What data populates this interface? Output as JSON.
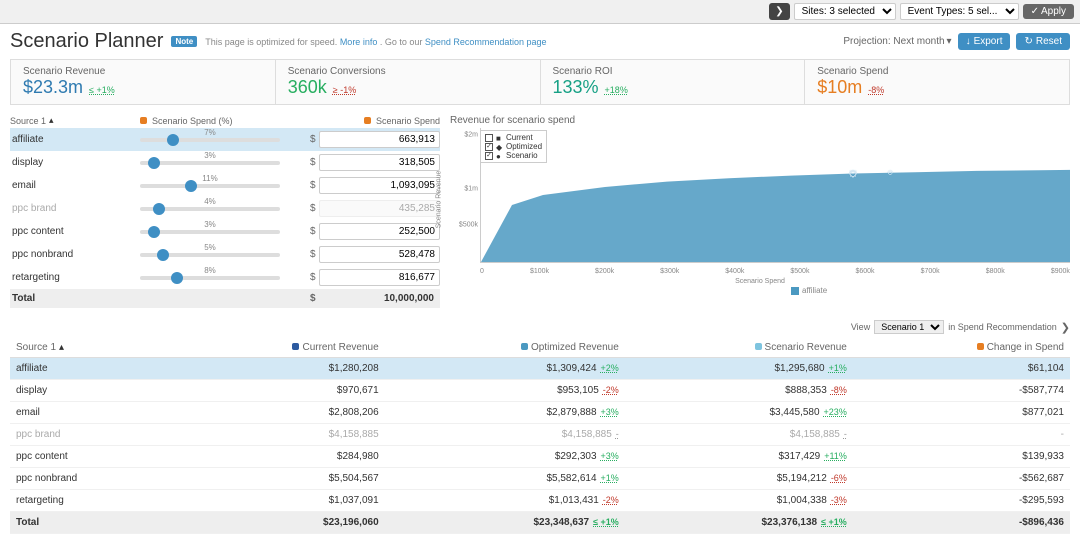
{
  "topbar": {
    "sites_label": "Sites: 3 selected",
    "event_types_label": "Event Types: 5 sel...",
    "apply_label": "Apply"
  },
  "header": {
    "title": "Scenario Planner",
    "note_badge": "Note",
    "note_text": "This page is optimized for speed.",
    "more_info": "More info",
    "goto_text": ". Go to our ",
    "rec_link": "Spend Recommendation page",
    "projection_label": "Projection:",
    "projection_value": "Next month",
    "export_label": "Export",
    "reset_label": "Reset"
  },
  "kpis": [
    {
      "label": "Scenario Revenue",
      "value": "$23.3m",
      "delta": "≤ +1%",
      "sign": "pos",
      "color": "blue"
    },
    {
      "label": "Scenario Conversions",
      "value": "360k",
      "delta": "≥ -1%",
      "sign": "neg",
      "color": "green"
    },
    {
      "label": "Scenario ROI",
      "value": "133%",
      "delta": "+18%",
      "sign": "pos",
      "color": "teal"
    },
    {
      "label": "Scenario Spend",
      "value": "$10m",
      "delta": "-8%",
      "sign": "neg",
      "color": "orange"
    }
  ],
  "editor": {
    "source_header": "Source 1",
    "pct_header": "Scenario Spend (%)",
    "val_header": "Scenario Spend",
    "rows": [
      {
        "source": "affiliate",
        "pct": "7%",
        "pct_pos": 7,
        "value": "663,913",
        "selected": true
      },
      {
        "source": "display",
        "pct": "3%",
        "pct_pos": 3,
        "value": "318,505"
      },
      {
        "source": "email",
        "pct": "11%",
        "pct_pos": 11,
        "value": "1,093,095"
      },
      {
        "source": "ppc brand",
        "pct": "4%",
        "pct_pos": 4,
        "value": "435,285",
        "disabled": true
      },
      {
        "source": "ppc content",
        "pct": "3%",
        "pct_pos": 3,
        "value": "252,500"
      },
      {
        "source": "ppc nonbrand",
        "pct": "5%",
        "pct_pos": 5,
        "value": "528,478"
      },
      {
        "source": "retargeting",
        "pct": "8%",
        "pct_pos": 8,
        "value": "816,677"
      }
    ],
    "total_label": "Total",
    "total_value": "10,000,000"
  },
  "chart": {
    "title": "Revenue for scenario spend",
    "legend": [
      {
        "name": "Current",
        "checked": false,
        "shape": "square"
      },
      {
        "name": "Optimized",
        "checked": true,
        "shape": "diamond"
      },
      {
        "name": "Scenario",
        "checked": true,
        "shape": "circle"
      }
    ],
    "y_ticks": [
      "$2m",
      "$1m",
      "$500k"
    ],
    "y_label": "Scenario Revenue",
    "x_ticks": [
      "0",
      "$100k",
      "$200k",
      "$300k",
      "$400k",
      "$500k",
      "$600k",
      "$700k",
      "$800k",
      "$900k"
    ],
    "x_label": "Scenario Spend",
    "series_name": "affiliate"
  },
  "chart_data": {
    "type": "area",
    "title": "Revenue for scenario spend",
    "xlabel": "Scenario Spend",
    "ylabel": "Scenario Revenue",
    "xlim": [
      0,
      950000
    ],
    "ylim": [
      0,
      2000000
    ],
    "series": [
      {
        "name": "affiliate",
        "x": [
          0,
          50000,
          100000,
          200000,
          300000,
          400000,
          500000,
          600000,
          700000,
          800000,
          900000,
          950000
        ],
        "y": [
          0,
          850000,
          1000000,
          1120000,
          1200000,
          1250000,
          1290000,
          1320000,
          1340000,
          1360000,
          1370000,
          1375000
        ]
      }
    ],
    "markers": [
      {
        "name": "Current",
        "x": 600000,
        "y": 1320000,
        "shape": "square"
      },
      {
        "name": "Optimized",
        "x": 600000,
        "y": 1320000,
        "shape": "diamond"
      },
      {
        "name": "Scenario",
        "x": 660000,
        "y": 1330000,
        "shape": "circle"
      }
    ]
  },
  "view_bar": {
    "label_view": "View",
    "scenario_option": "Scenario 1",
    "suffix": "in Spend Recommendation"
  },
  "table": {
    "headers": {
      "source": "Source 1",
      "current": "Current Revenue",
      "optimized": "Optimized Revenue",
      "scenario": "Scenario Revenue",
      "change": "Change in Spend"
    },
    "rows": [
      {
        "source": "affiliate",
        "current": "$1,280,208",
        "optimized": "$1,309,424",
        "opt_d": "+2%",
        "opt_s": "pos",
        "scenario": "$1,295,680",
        "sc_d": "+1%",
        "sc_s": "pos",
        "change": "$61,104",
        "selected": true
      },
      {
        "source": "display",
        "current": "$970,671",
        "optimized": "$953,105",
        "opt_d": "-2%",
        "opt_s": "neg",
        "scenario": "$888,353",
        "sc_d": "-8%",
        "sc_s": "neg",
        "change": "-$587,774"
      },
      {
        "source": "email",
        "current": "$2,808,206",
        "optimized": "$2,879,888",
        "opt_d": "+3%",
        "opt_s": "pos",
        "scenario": "$3,445,580",
        "sc_d": "+23%",
        "sc_s": "pos",
        "change": "$877,021"
      },
      {
        "source": "ppc brand",
        "current": "$4,158,885",
        "optimized": "$4,158,885",
        "opt_d": "-",
        "opt_s": "nil",
        "scenario": "$4,158,885",
        "sc_d": "-",
        "sc_s": "nil",
        "change": "-",
        "disabled": true
      },
      {
        "source": "ppc content",
        "current": "$284,980",
        "optimized": "$292,303",
        "opt_d": "+3%",
        "opt_s": "pos",
        "scenario": "$317,429",
        "sc_d": "+11%",
        "sc_s": "pos",
        "change": "$139,933"
      },
      {
        "source": "ppc nonbrand",
        "current": "$5,504,567",
        "optimized": "$5,582,614",
        "opt_d": "+1%",
        "opt_s": "pos",
        "scenario": "$5,194,212",
        "sc_d": "-6%",
        "sc_s": "neg",
        "change": "-$562,687"
      },
      {
        "source": "retargeting",
        "current": "$1,037,091",
        "optimized": "$1,013,431",
        "opt_d": "-2%",
        "opt_s": "neg",
        "scenario": "$1,004,338",
        "sc_d": "-3%",
        "sc_s": "neg",
        "change": "-$295,593"
      }
    ],
    "total": {
      "source": "Total",
      "current": "$23,196,060",
      "optimized": "$23,348,637",
      "opt_d": "≤ +1%",
      "opt_s": "pos",
      "scenario": "$23,376,138",
      "sc_d": "≤ +1%",
      "sc_s": "pos",
      "change": "-$896,436"
    }
  }
}
